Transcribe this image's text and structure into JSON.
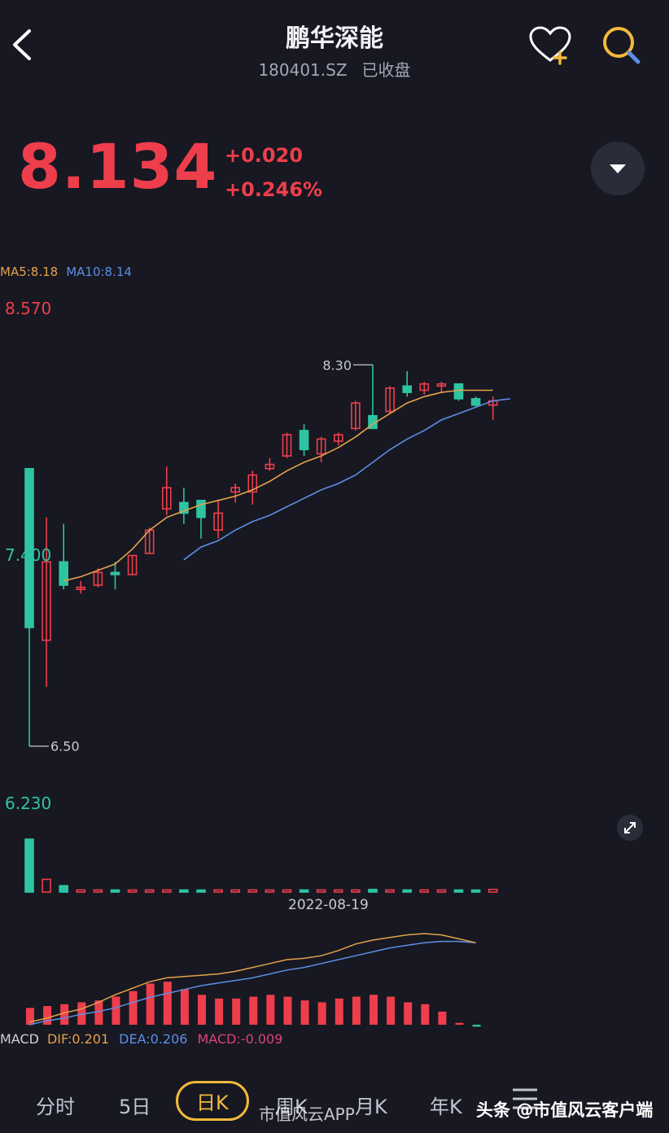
{
  "header": {
    "title": "鹏华深能",
    "code": "180401.SZ",
    "status": "已收盘"
  },
  "quote": {
    "price": "8.134",
    "change": "+0.020",
    "change_pct": "+0.246%",
    "color_up": "#ee3e4c",
    "color_down": "#2ec4a2"
  },
  "ma_legend": {
    "ma5": "MA5:8.18",
    "ma10": "MA10:8.14"
  },
  "axis": {
    "high": "8.570",
    "mid": "7.400",
    "low": "6.230"
  },
  "annotations": {
    "max": "8.30",
    "min": "6.50"
  },
  "volume": {
    "date": "2022-08-19"
  },
  "macd_legend": {
    "label": "MACD",
    "dif": "DIF:0.201",
    "dea": "DEA:0.206",
    "macd": "MACD:-0.009"
  },
  "tabs": [
    {
      "label": "分时"
    },
    {
      "label": "5日"
    },
    {
      "label": "日K",
      "active": true
    },
    {
      "label": "周K"
    },
    {
      "label": "月K"
    },
    {
      "label": "年K"
    }
  ],
  "watermarks": {
    "left": "市值风云APP",
    "right": "头条 @市值风云客户端"
  },
  "chart_data": {
    "type": "candlestick",
    "price_range": [
      6.23,
      8.57
    ],
    "candles": [
      {
        "o": 7.81,
        "c": 7.06,
        "h": 7.81,
        "l": 6.5
      },
      {
        "o": 7.0,
        "c": 7.37,
        "h": 7.58,
        "l": 6.78
      },
      {
        "o": 7.37,
        "c": 7.26,
        "h": 7.55,
        "l": 7.24
      },
      {
        "o": 7.24,
        "c": 7.25,
        "h": 7.28,
        "l": 7.22
      },
      {
        "o": 7.26,
        "c": 7.32,
        "h": 7.34,
        "l": 7.25
      },
      {
        "o": 7.32,
        "c": 7.31,
        "h": 7.37,
        "l": 7.24
      },
      {
        "o": 7.31,
        "c": 7.4,
        "h": 7.4,
        "l": 7.31
      },
      {
        "o": 7.41,
        "c": 7.52,
        "h": 7.53,
        "l": 7.41
      },
      {
        "o": 7.62,
        "c": 7.72,
        "h": 7.82,
        "l": 7.59
      },
      {
        "o": 7.65,
        "c": 7.6,
        "h": 7.72,
        "l": 7.55
      },
      {
        "o": 7.66,
        "c": 7.58,
        "h": 7.66,
        "l": 7.48
      },
      {
        "o": 7.52,
        "c": 7.6,
        "h": 7.66,
        "l": 7.48
      },
      {
        "o": 7.7,
        "c": 7.72,
        "h": 7.74,
        "l": 7.65
      },
      {
        "o": 7.7,
        "c": 7.78,
        "h": 7.8,
        "l": 7.64
      },
      {
        "o": 7.81,
        "c": 7.83,
        "h": 7.86,
        "l": 7.8
      },
      {
        "o": 7.87,
        "c": 7.97,
        "h": 7.98,
        "l": 7.86
      },
      {
        "o": 7.99,
        "c": 7.9,
        "h": 8.02,
        "l": 7.87
      },
      {
        "o": 7.88,
        "c": 7.95,
        "h": 7.96,
        "l": 7.84
      },
      {
        "o": 7.94,
        "c": 7.97,
        "h": 7.98,
        "l": 7.92
      },
      {
        "o": 8.0,
        "c": 8.12,
        "h": 8.13,
        "l": 7.99
      },
      {
        "o": 8.06,
        "c": 8.0,
        "h": 8.3,
        "l": 8.0
      },
      {
        "o": 8.08,
        "c": 8.19,
        "h": 8.2,
        "l": 8.07
      },
      {
        "o": 8.2,
        "c": 8.17,
        "h": 8.27,
        "l": 8.15
      },
      {
        "o": 8.18,
        "c": 8.21,
        "h": 8.22,
        "l": 8.16
      },
      {
        "o": 8.2,
        "c": 8.21,
        "h": 8.22,
        "l": 8.17
      },
      {
        "o": 8.21,
        "c": 8.14,
        "h": 8.21,
        "l": 8.13
      },
      {
        "o": 8.14,
        "c": 8.11,
        "h": 8.15,
        "l": 8.1
      },
      {
        "o": 8.11,
        "c": 8.13,
        "h": 8.15,
        "l": 8.04
      }
    ],
    "ma5": [
      7.28,
      7.3,
      7.33,
      7.36,
      7.43,
      7.52,
      7.58,
      7.61,
      7.64,
      7.66,
      7.68,
      7.71,
      7.75,
      7.8,
      7.84,
      7.87,
      7.91,
      7.96,
      8.02,
      8.07,
      8.12,
      8.15,
      8.17,
      8.18,
      8.18,
      8.18
    ],
    "ma10": [
      7.38,
      7.44,
      7.47,
      7.52,
      7.56,
      7.59,
      7.63,
      7.67,
      7.71,
      7.74,
      7.78,
      7.84,
      7.9,
      7.95,
      7.99,
      8.04,
      8.07,
      8.1,
      8.13,
      8.14
    ],
    "volume": [
      100,
      24,
      12,
      4,
      4,
      4,
      3,
      4,
      4,
      4,
      3,
      4,
      4,
      4,
      3,
      4,
      4,
      4,
      4,
      4,
      5,
      4,
      4,
      4,
      4,
      4,
      3,
      5
    ],
    "macd_hist": [
      0.09,
      0.1,
      0.11,
      0.12,
      0.13,
      0.15,
      0.18,
      0.22,
      0.23,
      0.19,
      0.16,
      0.14,
      0.14,
      0.15,
      0.16,
      0.15,
      0.13,
      0.12,
      0.14,
      0.15,
      0.16,
      0.15,
      0.12,
      0.11,
      0.07,
      0.01,
      -0.01
    ],
    "dif": [
      0.02,
      0.05,
      0.09,
      0.12,
      0.17,
      0.23,
      0.28,
      0.33,
      0.36,
      0.37,
      0.38,
      0.39,
      0.41,
      0.44,
      0.47,
      0.5,
      0.51,
      0.53,
      0.57,
      0.62,
      0.65,
      0.67,
      0.69,
      0.7,
      0.69,
      0.66,
      0.63
    ],
    "dea": [
      0.0,
      0.03,
      0.05,
      0.08,
      0.1,
      0.13,
      0.17,
      0.21,
      0.24,
      0.27,
      0.3,
      0.32,
      0.34,
      0.36,
      0.39,
      0.42,
      0.44,
      0.47,
      0.5,
      0.53,
      0.56,
      0.59,
      0.61,
      0.63,
      0.64,
      0.64,
      0.63
    ]
  }
}
